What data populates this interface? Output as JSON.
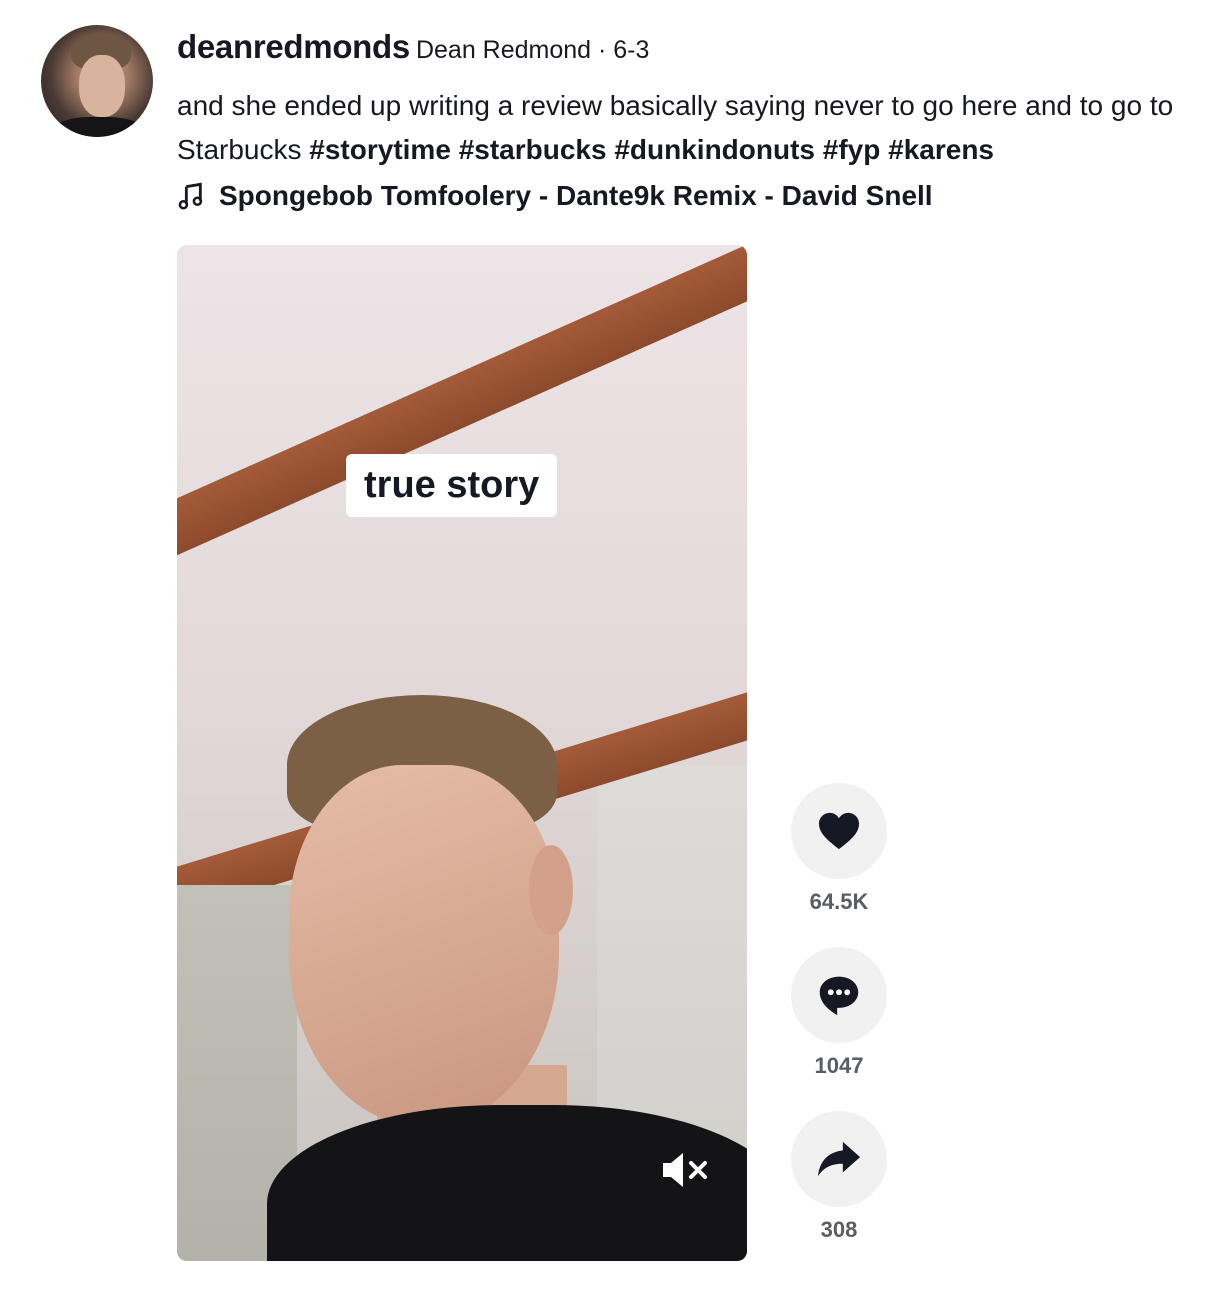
{
  "post": {
    "username": "deanredmonds",
    "nickname": "Dean Redmond · 6-3",
    "description": "and she ended up writing a review basically saying never to go here and to go to Starbucks",
    "hashtags": [
      "#storytime",
      "#starbucks",
      "#dunkindonuts",
      "#fyp",
      "#karens"
    ],
    "music": "Spongebob Tomfoolery - Dante9k Remix - David Snell"
  },
  "video": {
    "caption": "true story",
    "muted": true
  },
  "actions": {
    "likes": "64.5K",
    "comments": "1047",
    "shares": "308"
  },
  "icons": {
    "music": "music-note-icon",
    "like": "heart-icon",
    "comment": "comment-bubble-icon",
    "share": "share-arrow-icon",
    "mute": "speaker-muted-icon"
  },
  "colors": {
    "text": "#161823",
    "count": "#5b5d65",
    "action_bg": "#f1f1f2"
  }
}
